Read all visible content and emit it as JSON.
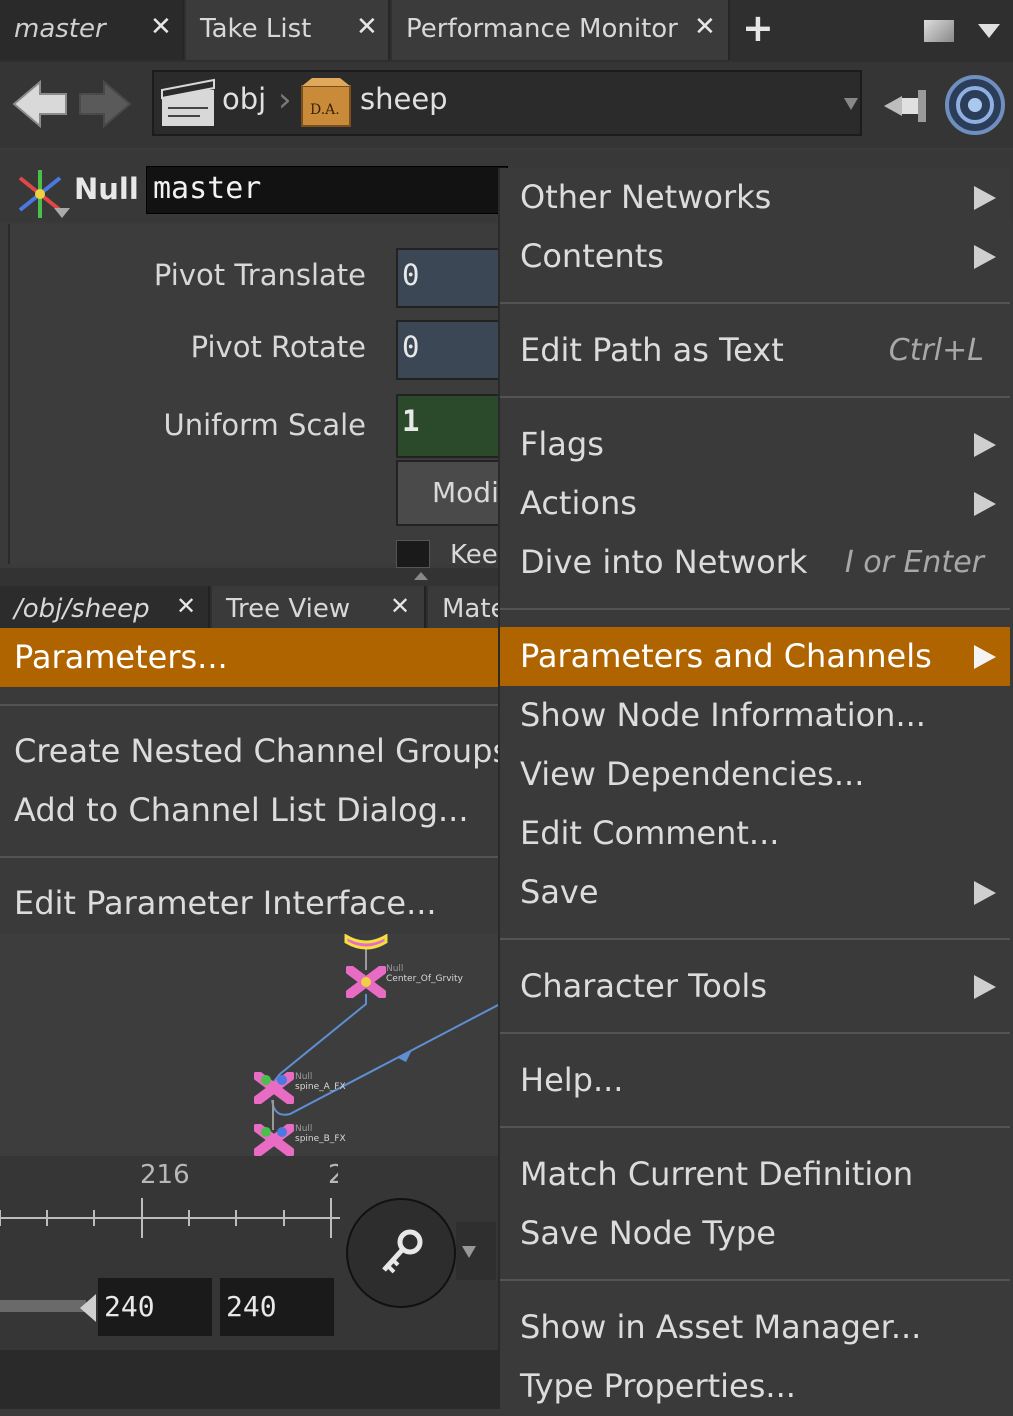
{
  "tabs": [
    {
      "label": "master"
    },
    {
      "label": "Take List"
    },
    {
      "label": "Performance Monitor"
    }
  ],
  "path": {
    "segment1": "obj",
    "segment2": "sheep"
  },
  "node": {
    "type": "Null",
    "name": "master"
  },
  "parameters": [
    {
      "label": "Pivot Translate",
      "value": "0"
    },
    {
      "label": "Pivot Rotate",
      "value": "0"
    },
    {
      "label": "Uniform Scale",
      "value": "1"
    }
  ],
  "partial": {
    "button": "Modi",
    "checkbox_label": "Kee"
  },
  "lower_tabs": [
    {
      "label": "/obj/sheep"
    },
    {
      "label": "Tree View"
    },
    {
      "label": "Mate"
    }
  ],
  "network": {
    "nodes": [
      {
        "type": "Null",
        "name": "Center_Of_Grvity"
      },
      {
        "type": "Null",
        "name": "spine_A_FX"
      },
      {
        "type": "Null",
        "name": "spine_B_FX"
      }
    ]
  },
  "timeline": {
    "tick_label": "216",
    "tick_label_partial": "2",
    "start": "240",
    "end": "240"
  },
  "context_menu": {
    "items": [
      {
        "label": "Other Networks",
        "submenu": true
      },
      {
        "label": "Contents",
        "submenu": true
      },
      {
        "label": "Edit Path as Text",
        "shortcut": "Ctrl+L"
      },
      {
        "label": "Flags",
        "submenu": true
      },
      {
        "label": "Actions",
        "submenu": true
      },
      {
        "label": "Dive into Network",
        "shortcut": "I or Enter"
      },
      {
        "label": "Parameters and Channels",
        "submenu": true,
        "highlighted": true
      },
      {
        "label": "Show Node Information..."
      },
      {
        "label": "View Dependencies..."
      },
      {
        "label": "Edit Comment..."
      },
      {
        "label": "Save",
        "submenu": true
      },
      {
        "label": "Character Tools",
        "submenu": true
      },
      {
        "label": "Help..."
      },
      {
        "label": "Match Current Definition"
      },
      {
        "label": "Save Node Type"
      },
      {
        "label": "Show in Asset Manager..."
      },
      {
        "label": "Type Properties..."
      }
    ]
  },
  "submenu": {
    "items": [
      {
        "label": "Parameters...",
        "highlighted": true
      },
      {
        "label": "Create Nested Channel Groups"
      },
      {
        "label": "Add to Channel List Dialog..."
      },
      {
        "label": "Edit Parameter Interface..."
      }
    ]
  },
  "colors": {
    "highlight": "#b06400",
    "background": "#3a3a3a",
    "field": "#3b4754",
    "field_green": "#2b4a2b",
    "wire": "#5f8fd0",
    "node_pink": "#e86cc4"
  }
}
